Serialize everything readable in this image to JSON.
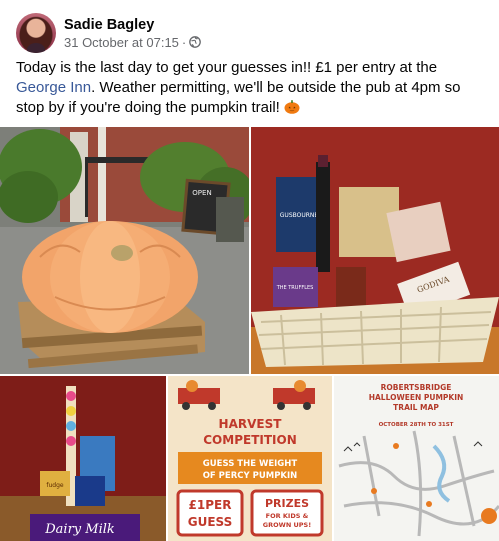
{
  "post": {
    "author": "Sadie Bagley",
    "timestamp": "31 October at 07:15",
    "separator": "·",
    "privacy_icon": "globe-icon",
    "text_before_link": "Today is the last day to get your guesses in!! £1 per entry at the ",
    "link_text": "George Inn",
    "text_after_link": ". Weather permitting, we'll be outside the pub at 4pm so stop by if you're doing the pumpkin trail! ",
    "emoji": "pumpkin-emoji"
  },
  "photos": {
    "pumpkin": {
      "sign_text": "OPEN"
    },
    "hamper": {
      "label_gusbourne": "GUSBOURNE",
      "label_godiva": "GODIVA",
      "label_truffles": "THE TRUFFLES"
    },
    "sweets": {
      "label_dairy_milk": "Dairy Milk",
      "label_fudge": "fudge"
    },
    "poster": {
      "line1": "HARVEST",
      "line2": "COMPETITION",
      "line3": "GUESS THE WEIGHT",
      "line4": "OF PERCY PUMPKIN",
      "price": "£1PER",
      "price2": "GUESS",
      "prizes": "PRIZES",
      "prizes_sub1": "FOR KIDS &",
      "prizes_sub2": "GROWN UPS!"
    },
    "map": {
      "title1": "ROBERTSBRIDGE",
      "title2": "HALLOWEEN PUMPKIN",
      "title3": "TRAIL MAP",
      "dates": "OCTOBER 28TH TO 31ST"
    }
  },
  "colors": {
    "link": "#385898",
    "meta": "#65676b",
    "poster_red": "#c0392b"
  }
}
